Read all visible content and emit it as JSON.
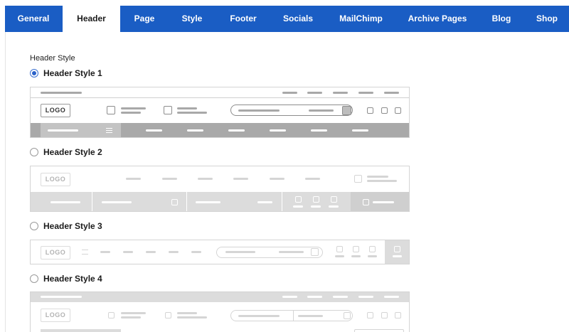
{
  "tabs": [
    {
      "label": "General",
      "active": false
    },
    {
      "label": "Header",
      "active": true
    },
    {
      "label": "Page",
      "active": false
    },
    {
      "label": "Style",
      "active": false
    },
    {
      "label": "Footer",
      "active": false
    },
    {
      "label": "Socials",
      "active": false
    },
    {
      "label": "MailChimp",
      "active": false
    },
    {
      "label": "Archive Pages",
      "active": false
    },
    {
      "label": "Blog",
      "active": false
    },
    {
      "label": "Shop",
      "active": false
    }
  ],
  "section": {
    "label": "Header Style"
  },
  "options": [
    {
      "label": "Header Style 1",
      "selected": true,
      "logo": "LOGO"
    },
    {
      "label": "Header Style 2",
      "selected": false,
      "logo": "LOGO"
    },
    {
      "label": "Header Style 3",
      "selected": false,
      "logo": "LOGO"
    },
    {
      "label": "Header Style 4",
      "selected": false,
      "logo": "LOGO"
    }
  ],
  "colors": {
    "tab_bar": "#1a5dc4",
    "radio_selected": "#2b62c9"
  },
  "icons": {
    "nav_menu": "hamburger-icon"
  }
}
